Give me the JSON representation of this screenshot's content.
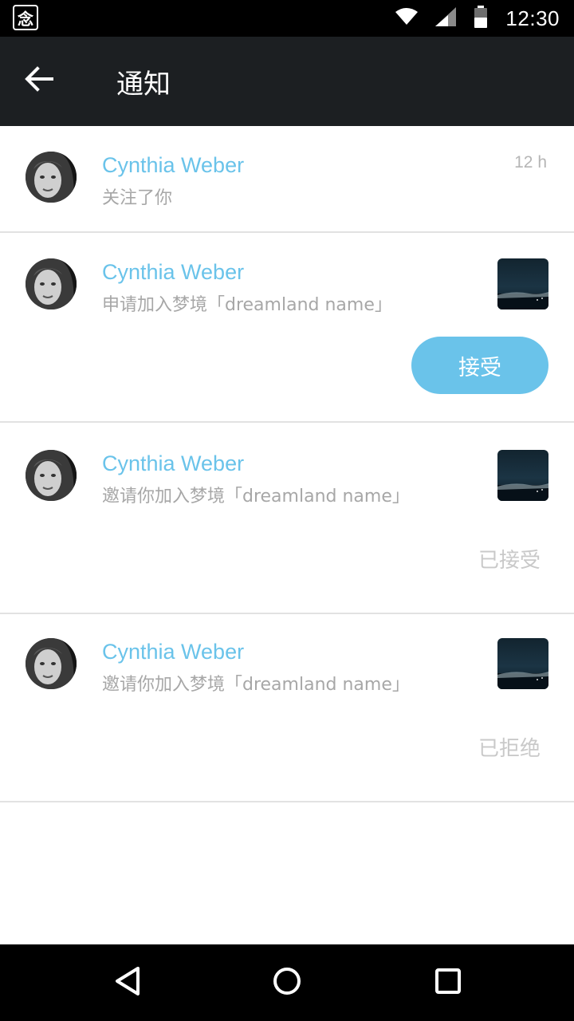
{
  "status_bar": {
    "app_icon_glyph": "念",
    "time": "12:30",
    "icons": [
      "wifi-icon",
      "cell-signal-icon",
      "battery-icon"
    ]
  },
  "toolbar": {
    "back_icon": "arrow-left-icon",
    "title": "通知"
  },
  "colors": {
    "accent": "#6ac3ea",
    "toolbar_bg": "#1c1f22",
    "muted_text": "#a7a7a7"
  },
  "notifications": [
    {
      "name": "Cynthia Weber",
      "text": "关注了你",
      "time": "12 h"
    },
    {
      "name": "Cynthia Weber",
      "text": "申请加入梦境「dreamland name」",
      "action_label": "接受"
    },
    {
      "name": "Cynthia Weber",
      "text": "邀请你加入梦境「dreamland name」",
      "status": "已接受"
    },
    {
      "name": "Cynthia Weber",
      "text": "邀请你加入梦境「dreamland name」",
      "status": "已拒绝"
    }
  ],
  "nav_bar": {
    "buttons": [
      "back-triangle-icon",
      "home-circle-icon",
      "recents-square-icon"
    ]
  }
}
